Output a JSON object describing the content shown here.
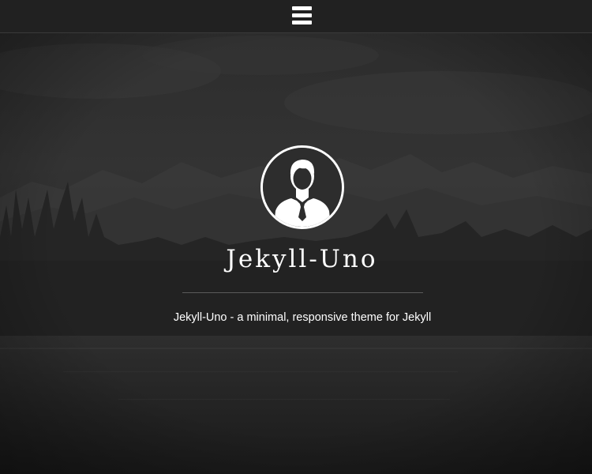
{
  "header": {
    "menu_icon": "hamburger-menu-icon"
  },
  "hero": {
    "avatar_icon": "user-avatar-icon",
    "title": "Jekyll-Uno",
    "tagline": "Jekyll-Uno - a minimal, responsive theme for Jekyll"
  },
  "colors": {
    "topbar_bg": "#212121",
    "text": "#ffffff",
    "background": "#262626"
  }
}
